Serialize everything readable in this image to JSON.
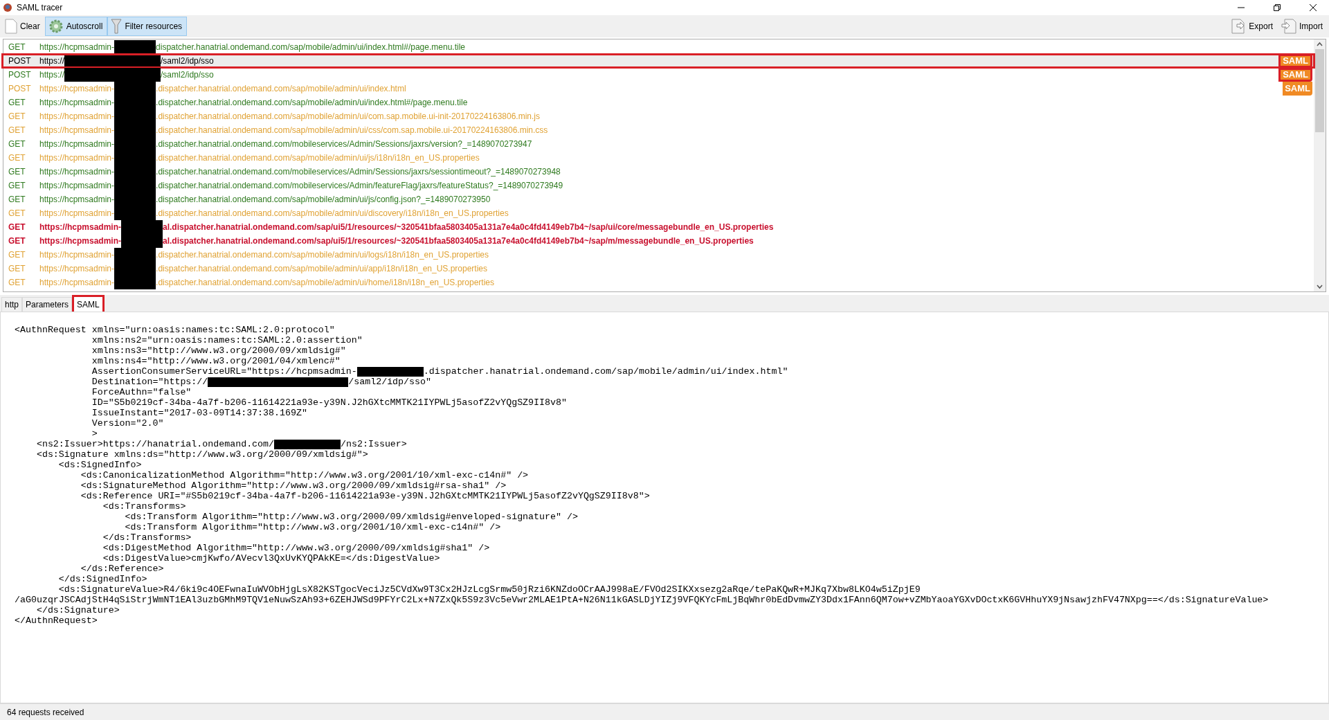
{
  "window": {
    "title": "SAML tracer"
  },
  "toolbar": {
    "left": [
      {
        "kind": "clear",
        "label": "Clear",
        "pressed": false
      },
      {
        "kind": "autoscroll",
        "label": "Autoscroll",
        "pressed": true
      },
      {
        "kind": "filter",
        "label": "Filter resources",
        "pressed": true
      }
    ],
    "right": [
      {
        "kind": "export",
        "label": "Export"
      },
      {
        "kind": "import",
        "label": "Import"
      }
    ]
  },
  "requests": [
    {
      "kind": "tenant",
      "method": "GET",
      "url_start": "https://hcpmsadmin-",
      "url_end": "dispatcher.hanatrial.ondemand.com/sap/mobile/admin/ui/index.html#/page.menu.tile",
      "color": "#2f7a1f",
      "bold": false,
      "selected": false,
      "annotated": false
    },
    {
      "kind": "host",
      "method": "POST",
      "url_start": "https://",
      "url_end": "/saml2/idp/sso",
      "color": "#000000",
      "bold": false,
      "selected": true,
      "annotated": true,
      "badge": "SAML",
      "badge_annotated": true
    },
    {
      "kind": "host",
      "method": "POST",
      "url_start": "https://",
      "url_end": "/saml2/idp/sso",
      "color": "#2f7a1f",
      "bold": false,
      "selected": false,
      "annotated": false,
      "badge": "SAML",
      "badge_annotated": true
    },
    {
      "kind": "tenant",
      "method": "POST",
      "url_start": "https://hcpmsadmin-",
      "url_end": ".dispatcher.hanatrial.ondemand.com/sap/mobile/admin/ui/index.html",
      "color": "#e0a234",
      "bold": false,
      "selected": false,
      "annotated": false,
      "badge": "SAML",
      "badge_annotated": false
    },
    {
      "kind": "tenant",
      "method": "GET",
      "url_start": "https://hcpmsadmin-",
      "url_end": ".dispatcher.hanatrial.ondemand.com/sap/mobile/admin/ui/index.html#/page.menu.tile",
      "color": "#2f7a1f",
      "bold": false,
      "selected": false,
      "annotated": false
    },
    {
      "kind": "tenant",
      "method": "GET",
      "url_start": "https://hcpmsadmin-",
      "url_end": ".dispatcher.hanatrial.ondemand.com/sap/mobile/admin/ui/com.sap.mobile.ui-init-20170224163806.min.js",
      "color": "#e0a234",
      "bold": false,
      "selected": false,
      "annotated": false
    },
    {
      "kind": "tenant",
      "method": "GET",
      "url_start": "https://hcpmsadmin-",
      "url_end": ".dispatcher.hanatrial.ondemand.com/sap/mobile/admin/ui/css/com.sap.mobile.ui-20170224163806.min.css",
      "color": "#e0a234",
      "bold": false,
      "selected": false,
      "annotated": false
    },
    {
      "kind": "tenant",
      "method": "GET",
      "url_start": "https://hcpmsadmin-",
      "url_end": ".dispatcher.hanatrial.ondemand.com/mobileservices/Admin/Sessions/jaxrs/version?_=1489070273947",
      "color": "#2f7a1f",
      "bold": false,
      "selected": false,
      "annotated": false
    },
    {
      "kind": "tenant",
      "method": "GET",
      "url_start": "https://hcpmsadmin-",
      "url_end": ".dispatcher.hanatrial.ondemand.com/sap/mobile/admin/ui/js/i18n/i18n_en_US.properties",
      "color": "#e0a234",
      "bold": false,
      "selected": false,
      "annotated": false
    },
    {
      "kind": "tenant",
      "method": "GET",
      "url_start": "https://hcpmsadmin-",
      "url_end": ".dispatcher.hanatrial.ondemand.com/mobileservices/Admin/Sessions/jaxrs/sessiontimeout?_=1489070273948",
      "color": "#2f7a1f",
      "bold": false,
      "selected": false,
      "annotated": false
    },
    {
      "kind": "tenant",
      "method": "GET",
      "url_start": "https://hcpmsadmin-",
      "url_end": ".dispatcher.hanatrial.ondemand.com/mobileservices/Admin/featureFlag/jaxrs/featureStatus?_=1489070273949",
      "color": "#2f7a1f",
      "bold": false,
      "selected": false,
      "annotated": false
    },
    {
      "kind": "tenant",
      "method": "GET",
      "url_start": "https://hcpmsadmin-",
      "url_end": ".dispatcher.hanatrial.ondemand.com/sap/mobile/admin/ui/js/config.json?_=1489070273950",
      "color": "#2f7a1f",
      "bold": false,
      "selected": false,
      "annotated": false
    },
    {
      "kind": "tenant",
      "method": "GET",
      "url_start": "https://hcpmsadmin-",
      "url_end": ".dispatcher.hanatrial.ondemand.com/sap/mobile/admin/ui/discovery/i18n/i18n_en_US.properties",
      "color": "#e0a234",
      "bold": false,
      "selected": false,
      "annotated": false
    },
    {
      "kind": "tenant",
      "method": "GET",
      "url_start": "https://hcpmsadmin-",
      "url_end": "al.dispatcher.hanatrial.ondemand.com/sap/ui5/1/resources/~320541bfaa5803405a131a7e4a0c4fd4149eb7b4~/sap/ui/core/messagebundle_en_US.properties",
      "color": "#c8102e",
      "bold": true,
      "selected": false,
      "annotated": false
    },
    {
      "kind": "tenant",
      "method": "GET",
      "url_start": "https://hcpmsadmin-",
      "url_end": "al.dispatcher.hanatrial.ondemand.com/sap/ui5/1/resources/~320541bfaa5803405a131a7e4a0c4fd4149eb7b4~/sap/m/messagebundle_en_US.properties",
      "color": "#c8102e",
      "bold": true,
      "selected": false,
      "annotated": false
    },
    {
      "kind": "tenant",
      "method": "GET",
      "url_start": "https://hcpmsadmin-",
      "url_end": ".dispatcher.hanatrial.ondemand.com/sap/mobile/admin/ui/logs/i18n/i18n_en_US.properties",
      "color": "#e0a234",
      "bold": false,
      "selected": false,
      "annotated": false
    },
    {
      "kind": "tenant",
      "method": "GET",
      "url_start": "https://hcpmsadmin-",
      "url_end": ".dispatcher.hanatrial.ondemand.com/sap/mobile/admin/ui/app/i18n/i18n_en_US.properties",
      "color": "#e0a234",
      "bold": false,
      "selected": false,
      "annotated": false
    },
    {
      "kind": "tenant",
      "method": "GET",
      "url_start": "https://hcpmsadmin-",
      "url_end": ".dispatcher.hanatrial.ondemand.com/sap/mobile/admin/ui/home/i18n/i18n_en_US.properties",
      "color": "#e0a234",
      "bold": false,
      "selected": false,
      "annotated": false
    }
  ],
  "tabs": [
    {
      "label": "http",
      "selected": false,
      "annotated": false
    },
    {
      "label": "Parameters",
      "selected": false,
      "annotated": false
    },
    {
      "label": "SAML",
      "selected": true,
      "annotated": true
    }
  ],
  "xml_lines": [
    {
      "kind": "plain",
      "text": "<AuthnRequest xmlns=\"urn:oasis:names:tc:SAML:2.0:protocol\""
    },
    {
      "kind": "plain",
      "text": "              xmlns:ns2=\"urn:oasis:names:tc:SAML:2.0:assertion\""
    },
    {
      "kind": "plain",
      "text": "              xmlns:ns3=\"http://www.w3.org/2000/09/xmldsig#\""
    },
    {
      "kind": "plain",
      "text": "              xmlns:ns4=\"http://www.w3.org/2001/04/xmlenc#\""
    },
    {
      "kind": "tenant",
      "before": "              AssertionConsumerServiceURL=\"https://hcpmsadmin-",
      "after": ".dispatcher.hanatrial.ondemand.com/sap/mobile/admin/ui/index.html\""
    },
    {
      "kind": "host",
      "before": "              Destination=\"https://",
      "after": "/saml2/idp/sso\""
    },
    {
      "kind": "plain",
      "text": "              ForceAuthn=\"false\""
    },
    {
      "kind": "plain",
      "text": "              ID=\"S5b0219cf-34ba-4a7f-b206-11614221a93e-y39N.J2hGXtcMMTK21IYPWLj5asofZ2vYQgSZ9II8v8\""
    },
    {
      "kind": "plain",
      "text": "              IssueInstant=\"2017-03-09T14:37:38.169Z\""
    },
    {
      "kind": "plain",
      "text": "              Version=\"2.0\""
    },
    {
      "kind": "plain",
      "text": "              >"
    },
    {
      "kind": "tenant",
      "before": "    <ns2:Issuer>https://hanatrial.ondemand.com/",
      "after": "/ns2:Issuer>"
    },
    {
      "kind": "plain",
      "text": "    <ds:Signature xmlns:ds=\"http://www.w3.org/2000/09/xmldsig#\">"
    },
    {
      "kind": "plain",
      "text": "        <ds:SignedInfo>"
    },
    {
      "kind": "plain",
      "text": "            <ds:CanonicalizationMethod Algorithm=\"http://www.w3.org/2001/10/xml-exc-c14n#\" />"
    },
    {
      "kind": "plain",
      "text": "            <ds:SignatureMethod Algorithm=\"http://www.w3.org/2000/09/xmldsig#rsa-sha1\" />"
    },
    {
      "kind": "plain",
      "text": "            <ds:Reference URI=\"#S5b0219cf-34ba-4a7f-b206-11614221a93e-y39N.J2hGXtcMMTK21IYPWLj5asofZ2vYQgSZ9II8v8\">"
    },
    {
      "kind": "plain",
      "text": "                <ds:Transforms>"
    },
    {
      "kind": "plain",
      "text": "                    <ds:Transform Algorithm=\"http://www.w3.org/2000/09/xmldsig#enveloped-signature\" />"
    },
    {
      "kind": "plain",
      "text": "                    <ds:Transform Algorithm=\"http://www.w3.org/2001/10/xml-exc-c14n#\" />"
    },
    {
      "kind": "plain",
      "text": "                </ds:Transforms>"
    },
    {
      "kind": "plain",
      "text": "                <ds:DigestMethod Algorithm=\"http://www.w3.org/2000/09/xmldsig#sha1\" />"
    },
    {
      "kind": "plain",
      "text": "                <ds:DigestValue>cmjKwfo/AVecvl3QxUvKYQPAkKE=</ds:DigestValue>"
    },
    {
      "kind": "plain",
      "text": "            </ds:Reference>"
    },
    {
      "kind": "plain",
      "text": "        </ds:SignedInfo>"
    },
    {
      "kind": "plain",
      "text": "        <ds:SignatureValue>R4/6ki9c4OEFwnaIuWVObHjgLsX82KSTgocVeciJz5CVdXw9T3Cx2HJzLcgSrmw50jRzi6KNZdoOCrAAJ998aE/FVOd2SIKXxsezg2aRqe/tePaKQwR+MJKq7Xbw8LKO4w5iZpjE9"
    },
    {
      "kind": "plain",
      "text": "/aG0uzqrJSCAdjStH4qSiStrjWmNT1EAl3uzbGMhM9TQV1eNuwSzAh93+6ZEHJWSd9PFYrC2Lx+N7ZxQk5S9z3Vc5eVwr2MLAE1PtA+N26N11kGASLDjYIZj9VFQKYcFmLjBqWhr0bEdDvmwZY3Ddx1FAnn6QM7ow+vZMbYaoaYGXvDOctxK6GVHhuYX9jNsawjzhFV47NXpg==</ds:SignatureValue>"
    },
    {
      "kind": "plain",
      "text": "    </ds:Signature>"
    },
    {
      "kind": "plain",
      "text": "</AuthnRequest>"
    }
  ],
  "status_bar": "64 requests received"
}
